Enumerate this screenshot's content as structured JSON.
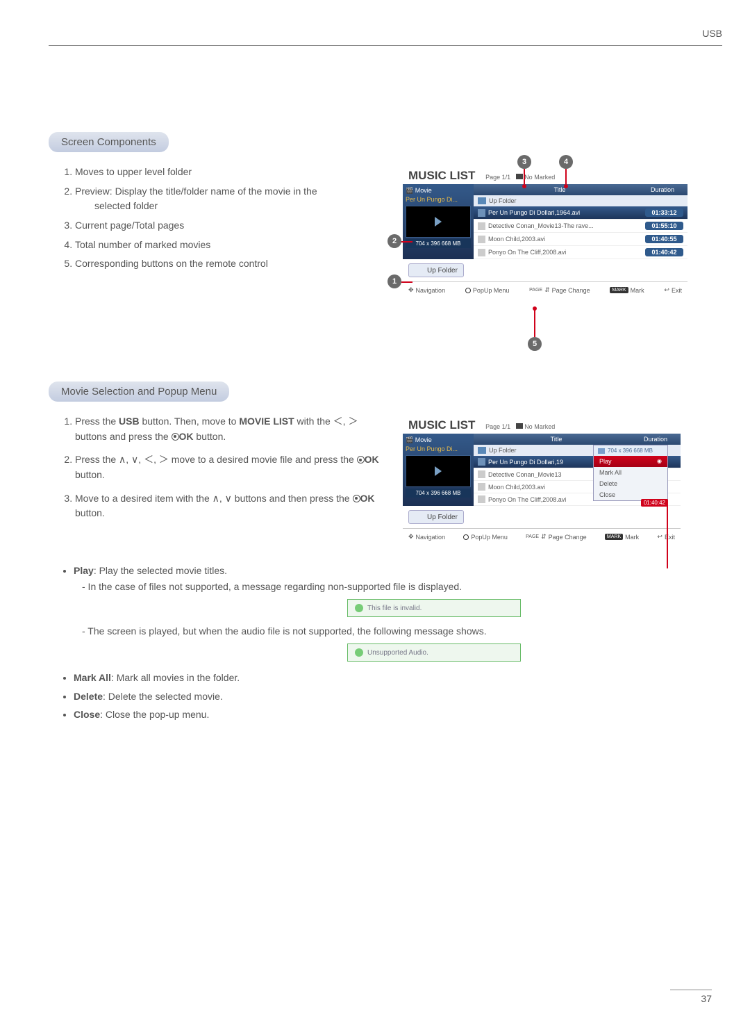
{
  "header": {
    "label": "USB",
    "page_number": "37"
  },
  "sections": {
    "screen_components": {
      "title": "Screen Components",
      "items": [
        "Moves to upper level folder",
        "Preview: Display the title/folder name of the movie in the selected folder",
        "Current page/Total pages",
        "Total number of marked movies",
        "Corresponding buttons on the remote control"
      ]
    },
    "movie_selection": {
      "title": "Movie Selection and Popup Menu",
      "steps": [
        {
          "pre": "Press the ",
          "b1": "USB",
          "mid1": " button. Then, move to ",
          "b2": "MOVIE LIST",
          "mid2": " with the ＜, ＞ buttons and press the ",
          "ok": true,
          "b3": "OK",
          "post": " button."
        },
        {
          "pre": "Press the ∧, ∨, ＜, ＞ move to a desired movie file and press the ",
          "ok": true,
          "b3": "OK",
          "post": " button."
        },
        {
          "pre": "Move to a desired item with the ∧, ∨ buttons and then press the ",
          "ok": true,
          "b3": "OK",
          "post": " button."
        }
      ]
    }
  },
  "screenshot": {
    "title": "MUSIC LIST",
    "page_info": "Page 1/1",
    "marked_info": "No Marked",
    "side": {
      "label": "Movie",
      "subtitle": "Per Un Pungo Di...",
      "dims": "704 x 396  668 MB"
    },
    "columns": {
      "title": "Title",
      "duration": "Duration"
    },
    "up_folder": "Up Folder",
    "files": [
      {
        "name": "Per Un Pungo Di Dollari,1964.avi",
        "dur": "01:33:12",
        "active": true
      },
      {
        "name": "Detective Conan_Movie13-The rave...",
        "dur": "01:55:10"
      },
      {
        "name": "Moon Child,2003.avi",
        "dur": "01:40:55"
      },
      {
        "name": "Ponyo On The Cliff,2008.avi",
        "dur": "01:40:42"
      }
    ],
    "up_folder_btn": "Up Folder",
    "footer": {
      "navigation": "Navigation",
      "popup": "PopUp Menu",
      "page_change_pre": "PAGE",
      "page_change": "Page Change",
      "mark_pre": "MARK",
      "mark": "Mark",
      "exit": "Exit"
    }
  },
  "screenshot2": {
    "title": "MUSIC LIST",
    "page_info": "Page 1/1",
    "marked_info": "No Marked",
    "side": {
      "label": "Movie",
      "subtitle": "Per Un Pungo Di...",
      "dims": "704 x 396  668 MB"
    },
    "columns": {
      "title": "Title",
      "duration": "Duration"
    },
    "files": [
      {
        "name": "Per Un Pungo Di Dollari,19",
        "active": true
      },
      {
        "name": "Detective Conan_Movie13"
      },
      {
        "name": "Moon Child,2003.avi"
      },
      {
        "name": "Ponyo On The Cliff,2008.avi"
      }
    ],
    "popup": {
      "thumb_dims": "704 x 396  668 MB",
      "items": [
        "Play",
        "Mark All",
        "Delete",
        "Close"
      ],
      "dur_overlay": "01:40:42"
    }
  },
  "play_desc": {
    "play_label": "Play",
    "play_text": ": Play the selected movie titles.",
    "dash1": "- In the case of files not supported, a message regarding non-supported file is displayed.",
    "msg1": "This file is invalid.",
    "dash2": "- The screen is played, but when the audio file is not supported, the following message shows.",
    "msg2": "Unsupported Audio.",
    "markall_label": "Mark All",
    "markall_text": ": Mark all movies in the folder.",
    "delete_label": "Delete",
    "delete_text": ": Delete the selected movie.",
    "close_label": "Close",
    "close_text": ": Close the pop-up menu."
  },
  "bubble_labels": {
    "b1": "1",
    "b2": "2",
    "b3": "3",
    "b4": "4",
    "b5": "5"
  }
}
